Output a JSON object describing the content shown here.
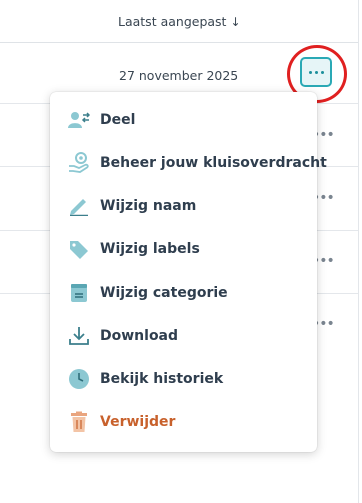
{
  "header": {
    "sort_label": "Laatst aangepast",
    "sort_arrow": "↓"
  },
  "rows": [
    {
      "date": "27 november 2025"
    }
  ],
  "row_more_button": {
    "icon": "ellipsis-icon"
  },
  "menu": {
    "items": [
      {
        "label": "Deel",
        "icon": "share-users-icon"
      },
      {
        "label": "Beheer jouw kluisoverdracht",
        "icon": "hand-transfer-icon"
      },
      {
        "label": "Wijzig naam",
        "icon": "pencil-icon"
      },
      {
        "label": "Wijzig labels",
        "icon": "tag-icon"
      },
      {
        "label": "Wijzig categorie",
        "icon": "category-icon"
      },
      {
        "label": "Download",
        "icon": "download-icon"
      },
      {
        "label": "Bekijk historiek",
        "icon": "clock-icon"
      },
      {
        "label": "Verwijder",
        "icon": "trash-icon",
        "danger": true
      }
    ]
  },
  "colors": {
    "accent": "#2aa9b5",
    "icon_fill": "#8cc8d2",
    "danger": "#c8612c",
    "annotation": "#e02020"
  }
}
